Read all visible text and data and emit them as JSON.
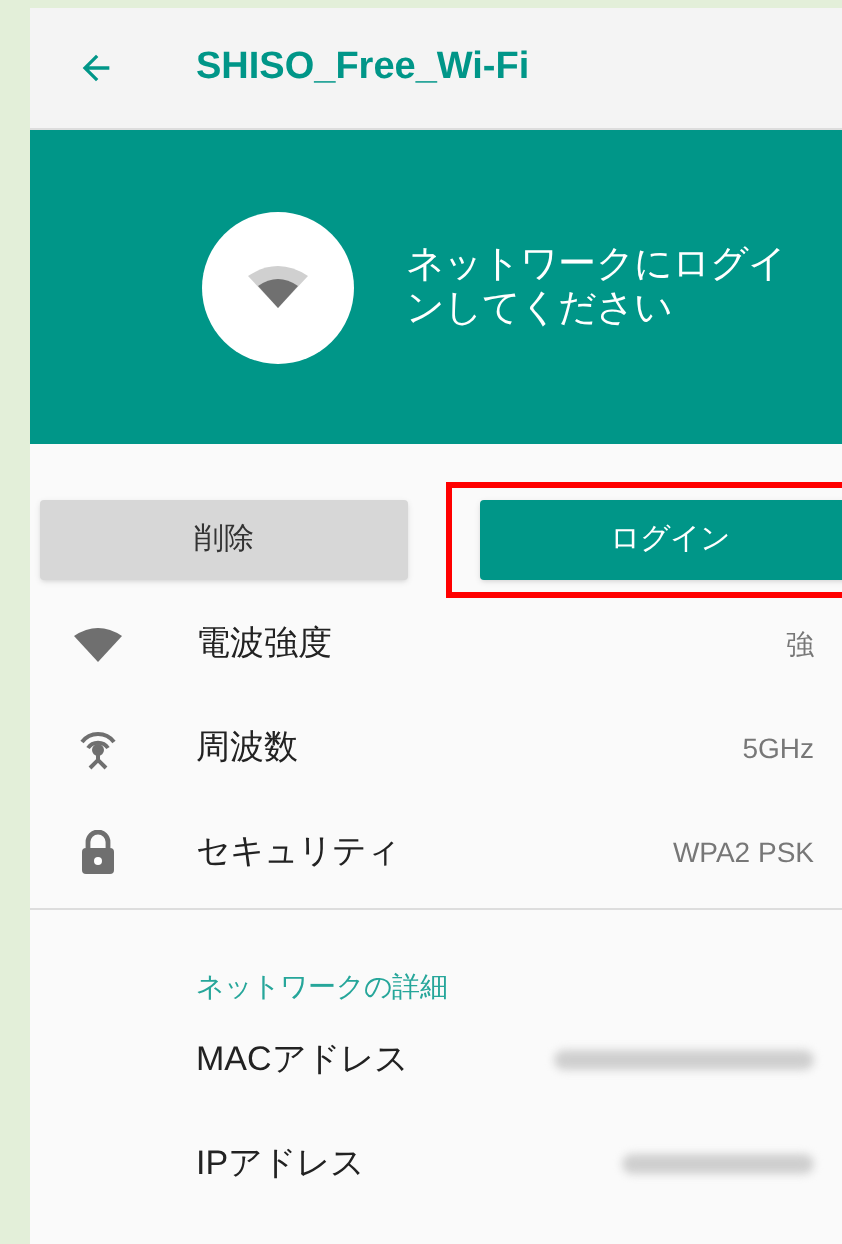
{
  "app_bar": {
    "title": "SHISO_Free_Wi-Fi"
  },
  "header": {
    "message": "ネットワークにログインしてください"
  },
  "buttons": [
    {
      "label": "削除",
      "kind": "secondary",
      "highlighted": false
    },
    {
      "label": "ログイン",
      "kind": "primary",
      "highlighted": true
    }
  ],
  "rows": [
    {
      "kind": "signal",
      "label": "電波強度",
      "value": "強"
    },
    {
      "kind": "frequency",
      "label": "周波数",
      "value": "5GHz"
    },
    {
      "kind": "security",
      "label": "セキュリティ",
      "value": "WPA2 PSK"
    }
  ],
  "details": {
    "title": "ネットワークの詳細",
    "items": [
      {
        "label": "MACアドレス",
        "redacted": true
      },
      {
        "label": "IPアドレス",
        "redacted": true
      }
    ]
  }
}
